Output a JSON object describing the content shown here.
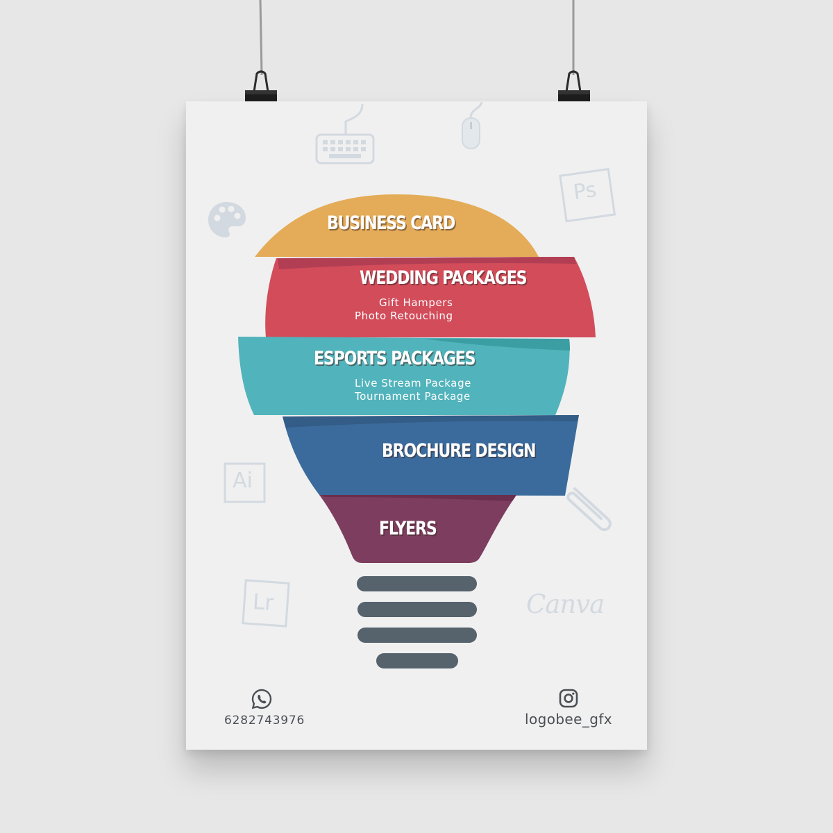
{
  "colors": {
    "business_card": "#e4ac58",
    "wedding": "#d24c5a",
    "esports": "#51b3bb",
    "brochure": "#3a6b9c",
    "flyers": "#7d3d5e",
    "base": "#56626c",
    "background": "#e7e7e7",
    "paper": "#f0f0f0",
    "icon_tint": "#d3d9e0"
  },
  "sections": {
    "business_card": {
      "title": "BUSINESS CARD"
    },
    "wedding": {
      "title": "WEDDING PACKAGES",
      "items": [
        "Gift Hampers",
        "Photo Retouching"
      ]
    },
    "esports": {
      "title": "ESPORTS PACKAGES",
      "items": [
        "Live Stream Package",
        "Tournament Package"
      ]
    },
    "brochure": {
      "title": "BROCHURE DESIGN"
    },
    "flyers": {
      "title": "FLYERS"
    }
  },
  "decor_icons": [
    "keyboard-icon",
    "mouse-icon",
    "photoshop-icon",
    "palette-icon",
    "illustrator-icon",
    "paperclip-icon",
    "lightroom-icon",
    "canva-logo"
  ],
  "decor_labels": {
    "photoshop": "Ps",
    "illustrator": "Ai",
    "lightroom": "Lr",
    "canva": "Canva"
  },
  "contact": {
    "whatsapp": {
      "icon": "whatsapp-icon",
      "number": "6282743976"
    },
    "instagram": {
      "icon": "instagram-icon",
      "handle": "logobee_gfx"
    }
  }
}
